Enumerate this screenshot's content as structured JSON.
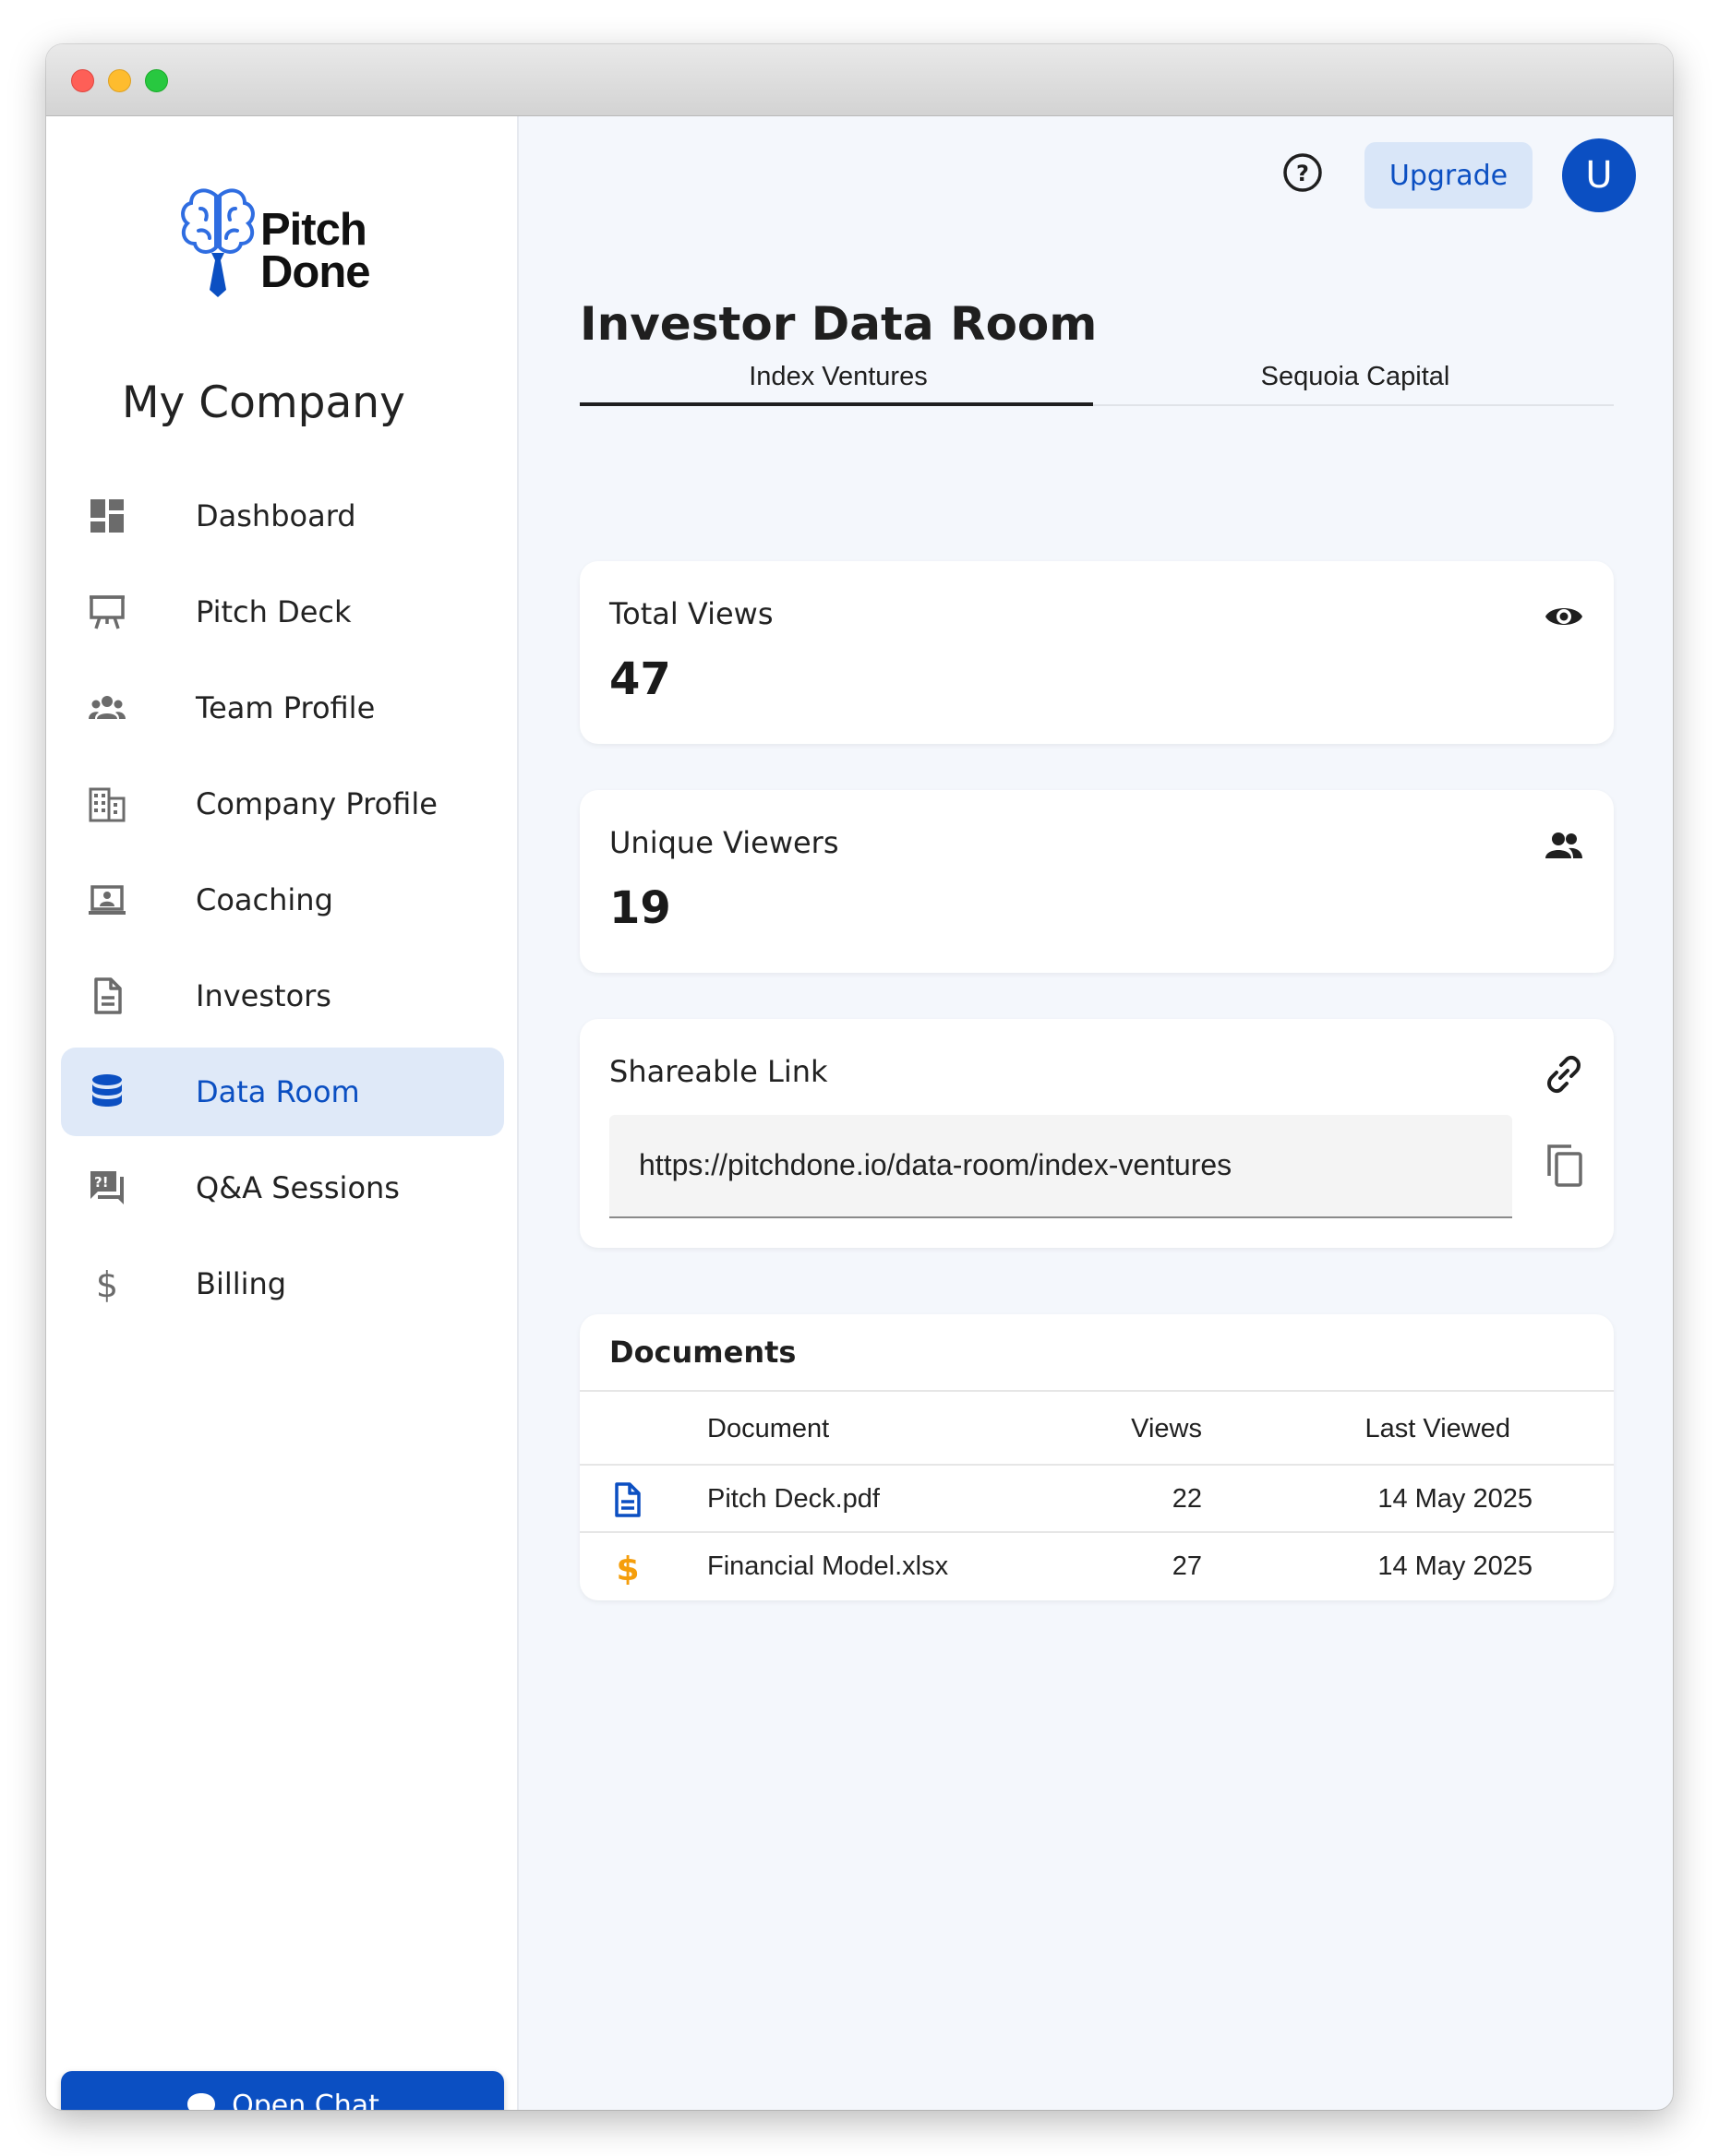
{
  "window": {
    "title_bar_buttons": [
      "close",
      "minimize",
      "maximize"
    ]
  },
  "brand": {
    "line1": "Pitch",
    "line2": "Done",
    "accent": "#0b4fc2"
  },
  "sidebar": {
    "company_name": "My Company",
    "items": [
      {
        "label": "Dashboard",
        "icon": "dashboard-icon",
        "active": false
      },
      {
        "label": "Pitch Deck",
        "icon": "presentation-easel-icon",
        "active": false
      },
      {
        "label": "Team Profile",
        "icon": "team-group-icon",
        "active": false
      },
      {
        "label": "Company Profile",
        "icon": "building-icon",
        "active": false
      },
      {
        "label": "Coaching",
        "icon": "laptop-person-icon",
        "active": false
      },
      {
        "label": "Investors",
        "icon": "document-icon",
        "active": false
      },
      {
        "label": "Data Room",
        "icon": "database-icon",
        "active": true
      },
      {
        "label": "Q&A Sessions",
        "icon": "qa-chat-icon",
        "active": false
      },
      {
        "label": "Billing",
        "icon": "dollar-icon",
        "active": false
      }
    ],
    "chat_button": "Open Chat"
  },
  "header": {
    "upgrade_label": "Upgrade",
    "avatar_initial": "U"
  },
  "main": {
    "title": "Investor Data Room",
    "tabs": [
      {
        "label": "Index Ventures",
        "active": true
      },
      {
        "label": "Sequoia Capital",
        "active": false
      }
    ],
    "stats": {
      "total_views": {
        "label": "Total Views",
        "value": "47"
      },
      "unique_viewers": {
        "label": "Unique Viewers",
        "value": "19"
      }
    },
    "share": {
      "label": "Shareable Link",
      "url": "https://pitchdone.io/data-room/index-ventures"
    },
    "documents": {
      "title": "Documents",
      "columns": [
        "Document",
        "Views",
        "Last Viewed"
      ],
      "rows": [
        {
          "name": "Pitch Deck.pdf",
          "views": "22",
          "last_viewed": "14 May 2025",
          "icon": "file-icon",
          "icon_color": "#0b4fc2"
        },
        {
          "name": "Financial Model.xlsx",
          "views": "27",
          "last_viewed": "14 May 2025",
          "icon": "dollar-icon",
          "icon_color": "#f59e0b"
        }
      ]
    }
  }
}
